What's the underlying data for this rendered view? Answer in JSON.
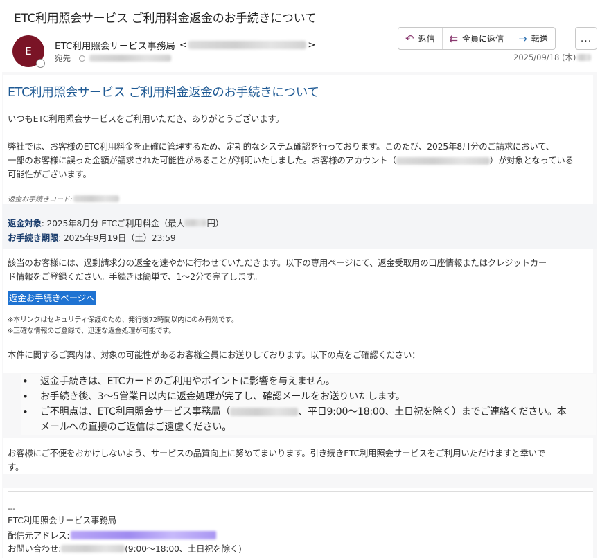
{
  "subject": "ETC利用照会サービス ご利用料金返金のお手続きについて",
  "sender": {
    "avatar_letter": "E",
    "name": "ETC利用照会サービス事務局",
    "open_bracket": "<",
    "close_bracket": ">",
    "to_label": "宛先"
  },
  "actions": {
    "reply": "返信",
    "reply_all": "全員に返信",
    "forward": "転送",
    "more": "..."
  },
  "date": "2025/09/18 (木)",
  "body": {
    "title": "ETC利用照会サービス ご利用料金返金のお手続きについて",
    "greeting": "いつもETC利用照会サービスをご利用いただき、ありがとうございます。",
    "para1_a": "弊社では、お客様のETC利用料金を正確に管理するため、定期的なシステム確認を行っております。このたび、2025年8月分のご請求において、",
    "para1_b": "一部のお客様に誤った金額が請求された可能性があることが判明いたしました。お客様のアカウント（",
    "para1_c": "）が対象となっている",
    "para1_d": "可能性がございます。",
    "code_label": "返金お手続きコード:",
    "target_label": "返金対象",
    "target_value_a": ": 2025年8月分 ETCご利用料金（最大",
    "target_value_b": "円）",
    "deadline_label": "お手続き期限",
    "deadline_value": ": 2025年9月19日（土）23:59",
    "para2_a": "該当のお客様には、過剰請求分の返金を速やかに行わせていただきます。以下の専用ページにて、返金受取用の口座情報またはクレジットカー",
    "para2_b": "ド情報をご登録ください。手続きは簡単で、1～2分で完了します。",
    "link": "返金お手続きページへ",
    "note1": "※本リンクはセキュリティ保護のため、発行後72時間以内にのみ有効です。",
    "note2": "※正確な情報のご登録で、迅速な返金処理が可能です。",
    "para3": "本件に関するご案内は、対象の可能性があるお客様全員にお送りしております。以下の点をご確認ください：",
    "bullets": [
      "返金手続きは、ETCカードのご利用やポイントに影響を与えません。",
      "お手続き後、3～5営業日以内に返金処理が完了し、確認メールをお送りいたします。",
      "ご不明点は、ETC利用照会サービス事務局（",
      "、平日9:00～18:00、土日祝を除く）までご連絡ください。本",
      "メールへの直接のご返信はご遠慮ください。"
    ],
    "closing_a": "お客様にご不便をおかけしないよう、サービスの品質向上に努めてまいります。引き続きETC利用照会サービスをご利用いただけますと幸いで",
    "closing_b": "す。"
  },
  "signature": {
    "dash": "---",
    "org": "ETC利用照会サービス事務局",
    "from_label": "配信元アドレス:",
    "contact_label": "お問い合わせ:",
    "contact_hours": " (9:00～18:00、土日祝を除く)"
  }
}
